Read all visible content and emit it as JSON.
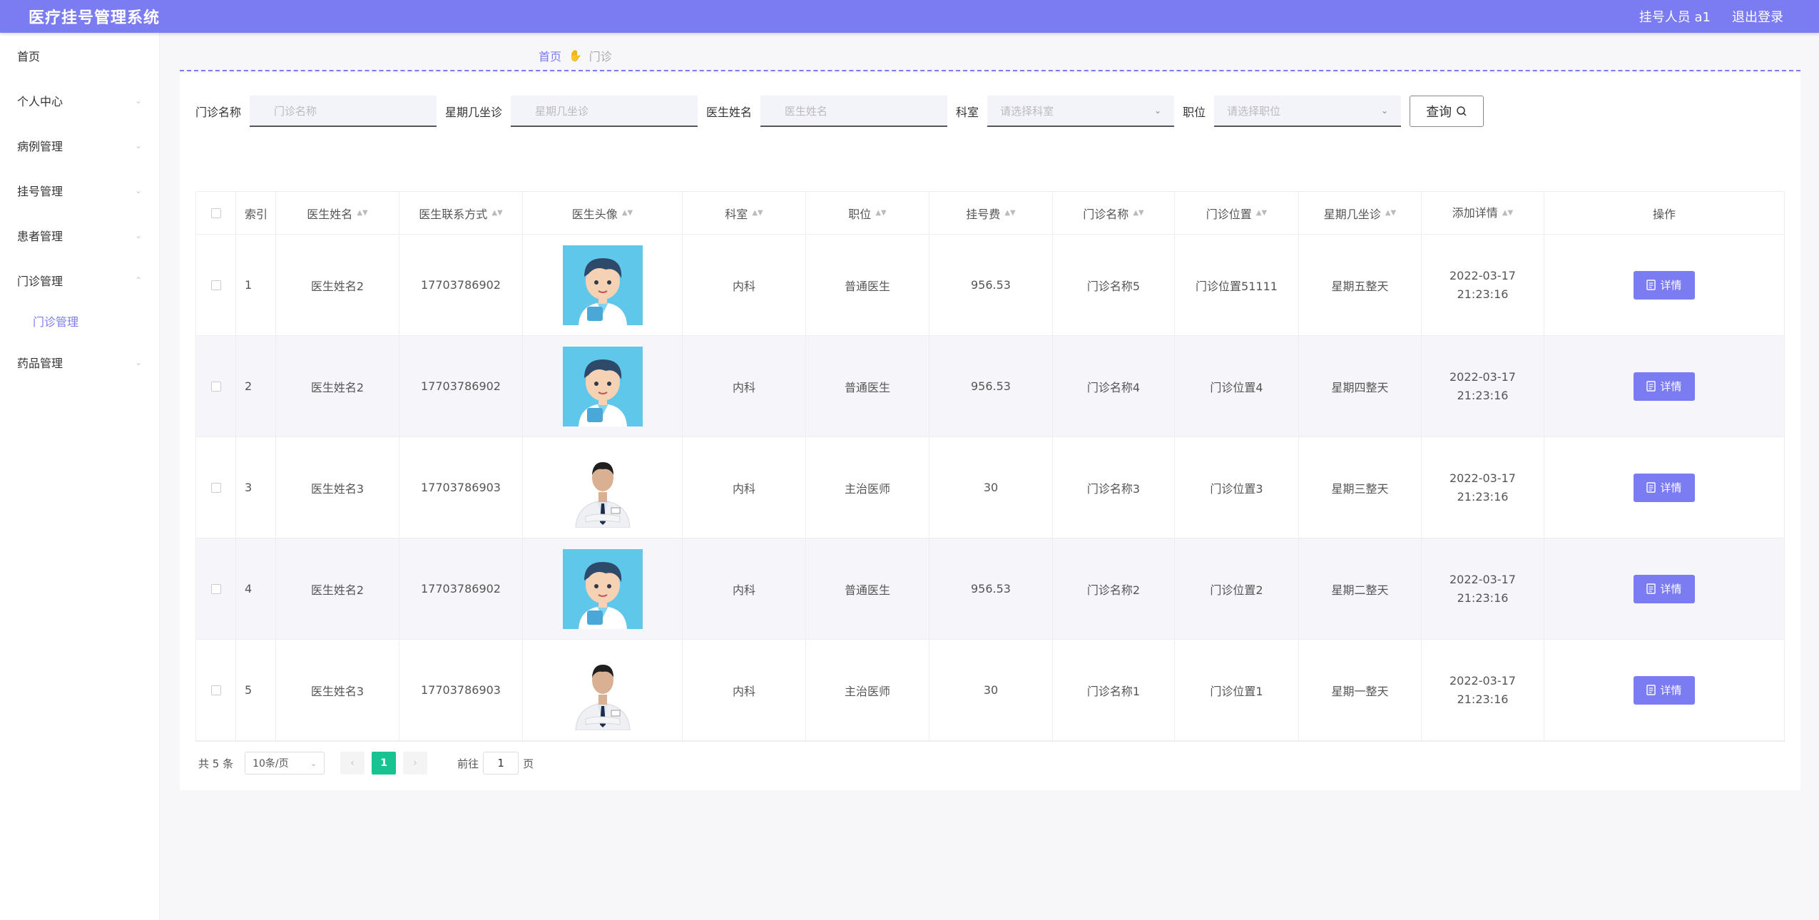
{
  "app": {
    "title": "医疗挂号管理系统",
    "user_label": "挂号人员 a1",
    "logout_label": "退出登录"
  },
  "sidebar": {
    "items": [
      {
        "label": "首页"
      },
      {
        "label": "个人中心"
      },
      {
        "label": "病例管理"
      },
      {
        "label": "挂号管理"
      },
      {
        "label": "患者管理"
      },
      {
        "label": "门诊管理"
      },
      {
        "label": "门诊管理"
      },
      {
        "label": "药品管理"
      }
    ]
  },
  "breadcrumb": {
    "home": "首页",
    "current": "门诊"
  },
  "search": {
    "clinic_name_label": "门诊名称",
    "clinic_name_placeholder": "门诊名称",
    "weekday_label": "星期几坐诊",
    "weekday_placeholder": "星期几坐诊",
    "doctor_label": "医生姓名",
    "doctor_placeholder": "医生姓名",
    "dept_label": "科室",
    "dept_placeholder": "请选择科室",
    "position_label": "职位",
    "position_placeholder": "请选择职位",
    "query_label": "查询"
  },
  "table": {
    "headers": {
      "index": "索引",
      "name": "医生姓名",
      "phone": "医生联系方式",
      "avatar": "医生头像",
      "dept": "科室",
      "position": "职位",
      "fee": "挂号费",
      "clinic_name": "门诊名称",
      "clinic_pos": "门诊位置",
      "weekday": "星期几坐诊",
      "added": "添加详情",
      "op": "操作"
    },
    "detail_label": "详情",
    "rows": [
      {
        "index": "1",
        "name": "医生姓名2",
        "phone": "17703786902",
        "avatar": "cartoon-doctor",
        "dept": "内科",
        "position": "普通医生",
        "fee": "956.53",
        "clinic_name": "门诊名称5",
        "clinic_pos": "门诊位置51111",
        "weekday": "星期五整天",
        "added": "2022-03-17 21:23:16"
      },
      {
        "index": "2",
        "name": "医生姓名2",
        "phone": "17703786902",
        "avatar": "cartoon-doctor",
        "dept": "内科",
        "position": "普通医生",
        "fee": "956.53",
        "clinic_name": "门诊名称4",
        "clinic_pos": "门诊位置4",
        "weekday": "星期四整天",
        "added": "2022-03-17 21:23:16"
      },
      {
        "index": "3",
        "name": "医生姓名3",
        "phone": "17703786903",
        "avatar": "photo-doctor",
        "dept": "内科",
        "position": "主治医师",
        "fee": "30",
        "clinic_name": "门诊名称3",
        "clinic_pos": "门诊位置3",
        "weekday": "星期三整天",
        "added": "2022-03-17 21:23:16"
      },
      {
        "index": "4",
        "name": "医生姓名2",
        "phone": "17703786902",
        "avatar": "cartoon-doctor",
        "dept": "内科",
        "position": "普通医生",
        "fee": "956.53",
        "clinic_name": "门诊名称2",
        "clinic_pos": "门诊位置2",
        "weekday": "星期二整天",
        "added": "2022-03-17 21:23:16"
      },
      {
        "index": "5",
        "name": "医生姓名3",
        "phone": "17703786903",
        "avatar": "photo-doctor",
        "dept": "内科",
        "position": "主治医师",
        "fee": "30",
        "clinic_name": "门诊名称1",
        "clinic_pos": "门诊位置1",
        "weekday": "星期一整天",
        "added": "2022-03-17 21:23:16"
      }
    ]
  },
  "pagination": {
    "total_label": "共 5 条",
    "page_size": "10条/页",
    "current_page": "1",
    "goto_label": "前往",
    "goto_value": "1",
    "page_suffix": "页"
  },
  "colors": {
    "accent": "#7b7bf2",
    "page_active": "#18c392"
  }
}
